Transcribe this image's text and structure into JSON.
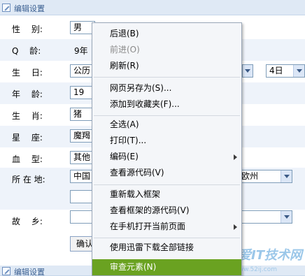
{
  "sections": {
    "top_title": "编辑设置",
    "bottom_title": "编辑设置"
  },
  "form": {
    "gender_label": "性　 别:",
    "gender_value": "男",
    "qage_label": "Q　 龄:",
    "qage_value": "9年",
    "birthday_label": "生　 日:",
    "birthday_calendar": "公历",
    "birthday_day": "4日",
    "age_label": "年　 龄:",
    "age_value": "19",
    "zodiac_label": "生　 肖:",
    "zodiac_value": "猪",
    "constellation_label": "星　 座:",
    "constellation_value": "魔羯",
    "blood_label": "血　 型:",
    "blood_value": "其他",
    "location_label": "所 在 地:",
    "location_country": "中国",
    "location_city": "欧州",
    "hometown_label": "故　 乡:",
    "confirm_label": "确认"
  },
  "context_menu": {
    "items": [
      {
        "label": "后退(B)",
        "disabled": false
      },
      {
        "label": "前进(O)",
        "disabled": true
      },
      {
        "label": "刷新(R)",
        "disabled": false
      },
      {
        "label": "网页另存为(S)...",
        "disabled": false
      },
      {
        "label": "添加到收藏夹(F)...",
        "disabled": false
      },
      {
        "label": "全选(A)",
        "disabled": false
      },
      {
        "label": "打印(T)...",
        "disabled": false
      },
      {
        "label": "编码(E)",
        "disabled": false,
        "submenu": true
      },
      {
        "label": "查看源代码(V)",
        "disabled": false
      },
      {
        "label": "重新载入框架",
        "disabled": false
      },
      {
        "label": "查看框架的源代码(V)",
        "disabled": false
      },
      {
        "label": "在手机打开当前页面",
        "disabled": false,
        "submenu": true
      },
      {
        "label": "使用迅雷下载全部链接",
        "disabled": false
      },
      {
        "label": "审查元素(N)",
        "disabled": false,
        "highlighted": true
      }
    ]
  },
  "watermark": {
    "text": "我爱IT技术网",
    "sub": "www.52ij.com"
  },
  "colors": {
    "menu_highlight": "#6aa221",
    "header_bg": "#dfe9f5",
    "row_alt_bg": "#eef3fa"
  }
}
